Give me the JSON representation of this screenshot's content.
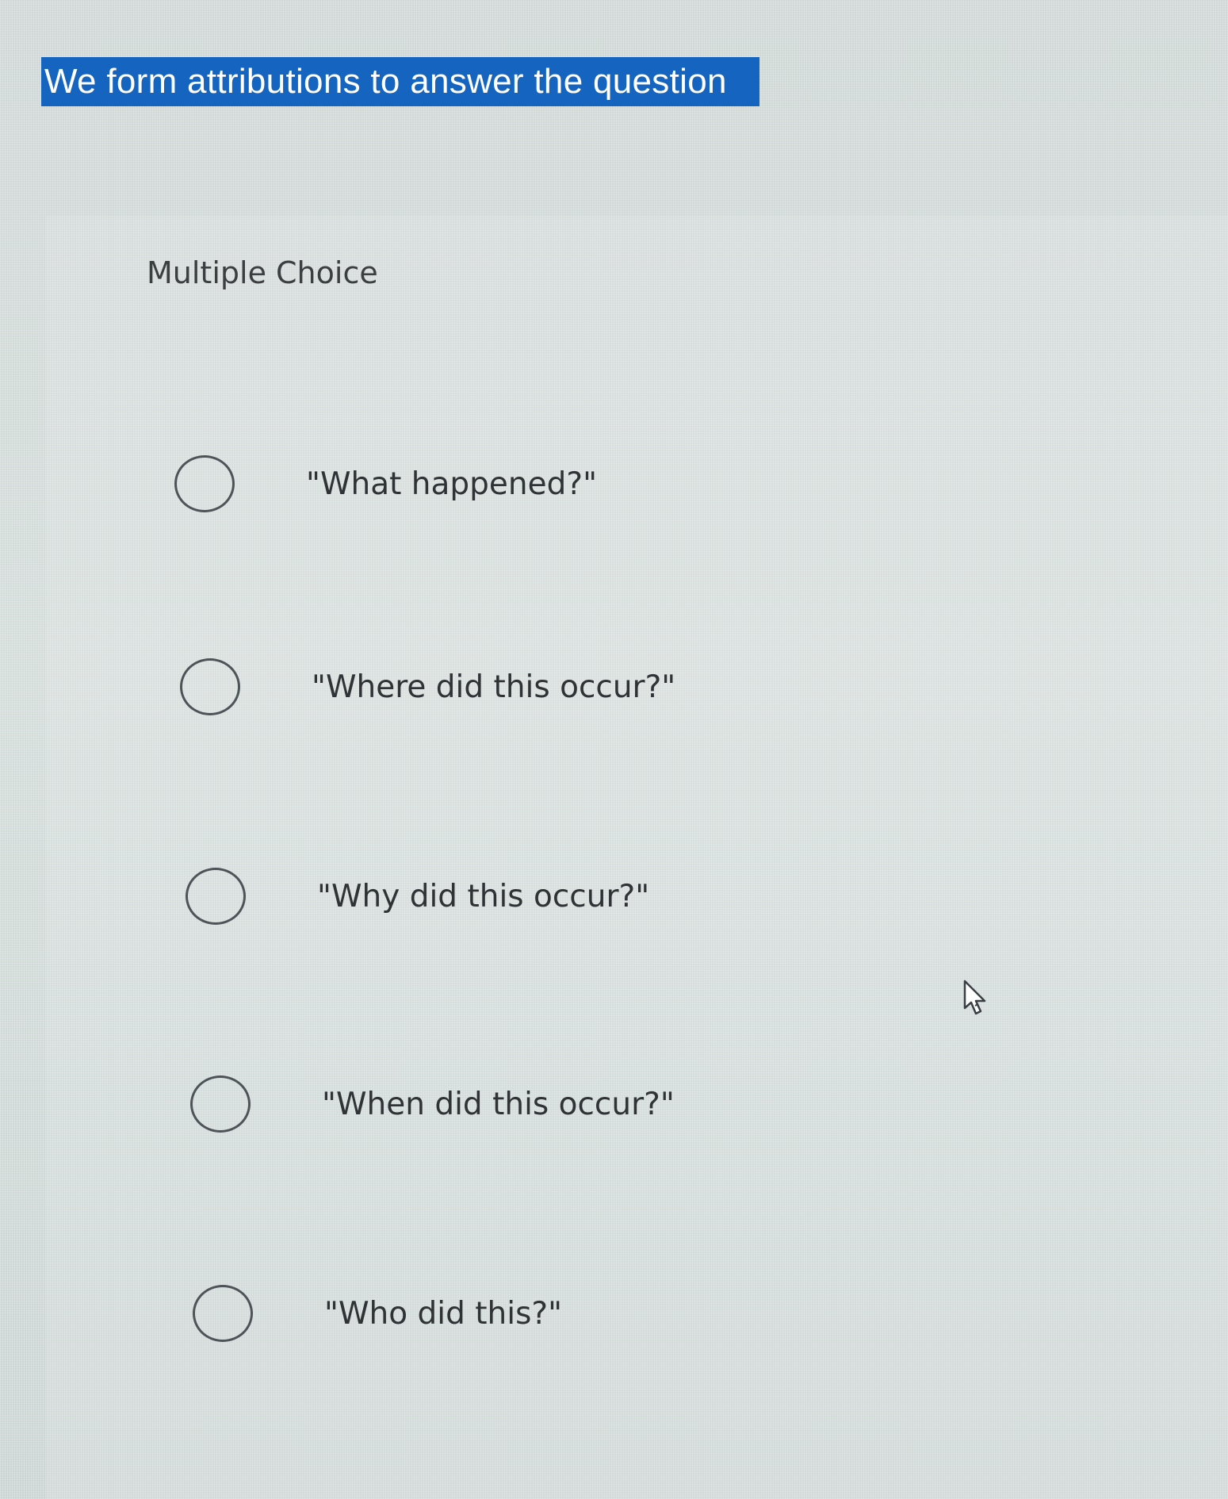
{
  "question": {
    "text": "We form attributions to answer the question"
  },
  "question_type": "Multiple Choice",
  "choices": [
    {
      "label": "\"What happened?\"",
      "selected": false
    },
    {
      "label": "\"Where did this occur?\"",
      "selected": false
    },
    {
      "label": "\"Why did this occur?\"",
      "selected": false
    },
    {
      "label": "\"When did this occur?\"",
      "selected": false
    },
    {
      "label": "\"Who did this?\"",
      "selected": false
    }
  ],
  "colors": {
    "highlight": "#1565c0",
    "background": "#dde5e3",
    "text": "#2f3336",
    "radio_border": "#4d5357"
  },
  "icons": {
    "cursor": "hand-pointer-icon"
  }
}
